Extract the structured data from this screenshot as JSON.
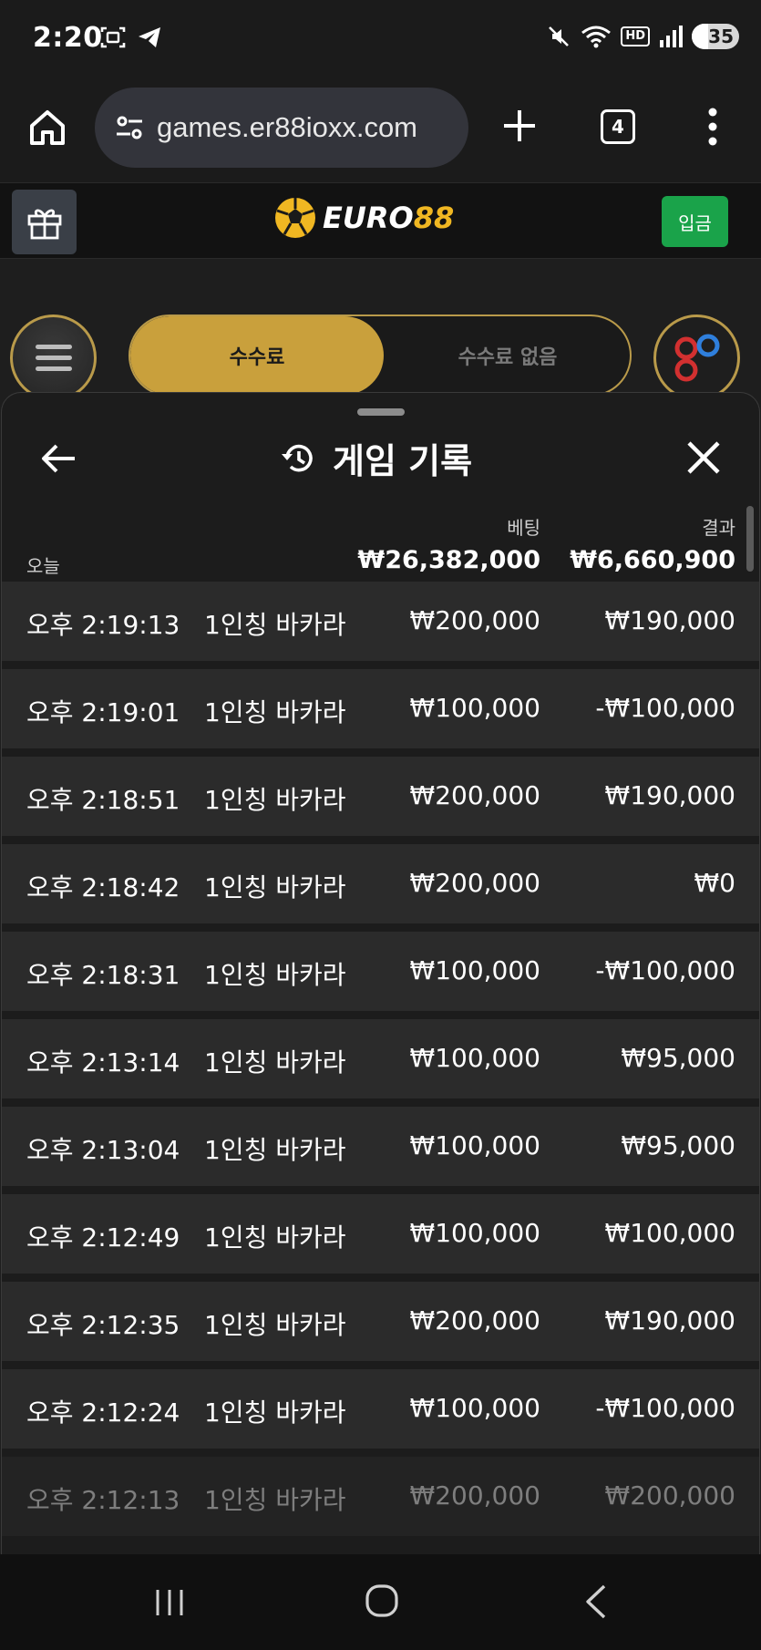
{
  "status_bar": {
    "time": "2:20",
    "battery": "35",
    "hd": "HD"
  },
  "browser": {
    "url": "games.er88ioxx.com",
    "tab_count": "4"
  },
  "site": {
    "logo_part1": "EURO",
    "logo_part2": "88",
    "deposit_label": "입금",
    "fee_on_label": "수수료",
    "fee_off_label": "수수료 없음"
  },
  "sheet": {
    "title": "게임 기록",
    "today_label": "오늘",
    "bet_header": "베팅",
    "result_header": "결과",
    "bet_total": "₩26,382,000",
    "result_total": "₩6,660,900"
  },
  "records": [
    {
      "time": "오후 2:19:13",
      "game": "1인칭 바카라",
      "bet": "₩200,000",
      "result": "₩190,000"
    },
    {
      "time": "오후 2:19:01",
      "game": "1인칭 바카라",
      "bet": "₩100,000",
      "result": "-₩100,000"
    },
    {
      "time": "오후 2:18:51",
      "game": "1인칭 바카라",
      "bet": "₩200,000",
      "result": "₩190,000"
    },
    {
      "time": "오후 2:18:42",
      "game": "1인칭 바카라",
      "bet": "₩200,000",
      "result": "₩0"
    },
    {
      "time": "오후 2:18:31",
      "game": "1인칭 바카라",
      "bet": "₩100,000",
      "result": "-₩100,000"
    },
    {
      "time": "오후 2:13:14",
      "game": "1인칭 바카라",
      "bet": "₩100,000",
      "result": "₩95,000"
    },
    {
      "time": "오후 2:13:04",
      "game": "1인칭 바카라",
      "bet": "₩100,000",
      "result": "₩95,000"
    },
    {
      "time": "오후 2:12:49",
      "game": "1인칭 바카라",
      "bet": "₩100,000",
      "result": "₩100,000"
    },
    {
      "time": "오후 2:12:35",
      "game": "1인칭 바카라",
      "bet": "₩200,000",
      "result": "₩190,000"
    },
    {
      "time": "오후 2:12:24",
      "game": "1인칭 바카라",
      "bet": "₩100,000",
      "result": "-₩100,000"
    },
    {
      "time": "오후 2:12:13",
      "game": "1인칭 바카라",
      "bet": "₩200,000",
      "result": "₩200,000"
    }
  ],
  "colors": {
    "accent_gold": "#c9a03c",
    "deposit_green": "#1aa34a",
    "background": "#1b1b1b",
    "row_background": "#2b2b2b"
  },
  "icons": {
    "home": "home-icon",
    "tune": "tune-icon",
    "plus": "plus-icon",
    "menu": "more-vert-icon",
    "gift": "gift-icon",
    "hamburger": "hamburger-icon",
    "games": "games-rings-icon",
    "back": "arrow-left-icon",
    "history": "history-icon",
    "close": "close-icon"
  }
}
